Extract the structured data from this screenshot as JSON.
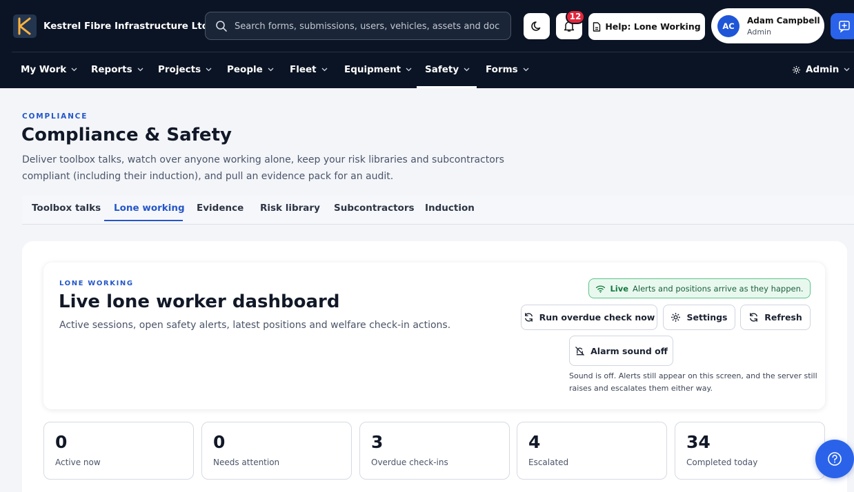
{
  "app": {
    "company": "Kestrel Fibre Infrastructure Ltd",
    "search_placeholder": "Search forms, submissions, users, vehicles, assets and docu",
    "notification_count": "12",
    "help_label": "Help: Lone Working",
    "user": {
      "initials": "AC",
      "name": "Adam Campbell",
      "role": "Admin"
    },
    "brand_color": "#2a63ea"
  },
  "nav": {
    "items": [
      "My Work",
      "Reports",
      "Projects",
      "People",
      "Fleet",
      "Equipment",
      "Safety",
      "Forms"
    ],
    "active": "Safety",
    "admin_label": "Admin"
  },
  "page": {
    "eyebrow": "COMPLIANCE",
    "title": "Compliance & Safety",
    "description": "Deliver toolbox talks, watch over anyone working alone, keep your risk libraries and subcontractors compliant (including their induction), and pull an evidence pack for an audit.",
    "tabs": [
      "Toolbox talks",
      "Lone working",
      "Evidence",
      "Risk library",
      "Subcontractors",
      "Induction"
    ],
    "active_tab": "Lone working"
  },
  "dashboard": {
    "eyebrow": "LONE WORKING",
    "title": "Live lone worker dashboard",
    "description": "Active sessions, open safety alerts, latest positions and welfare check-in actions.",
    "live_label": "Live",
    "live_text": "Alerts and positions arrive as they happen.",
    "run_check_label": "Run overdue check now",
    "settings_label": "Settings",
    "refresh_label": "Refresh",
    "alarm_label": "Alarm sound off",
    "sound_note": "Sound is off. Alerts still appear on this screen, and the server still raises and escalates them either way."
  },
  "stats": [
    {
      "value": "0",
      "label": "Active now"
    },
    {
      "value": "0",
      "label": "Needs attention"
    },
    {
      "value": "3",
      "label": "Overdue check-ins"
    },
    {
      "value": "4",
      "label": "Escalated"
    },
    {
      "value": "34",
      "label": "Completed today"
    }
  ]
}
